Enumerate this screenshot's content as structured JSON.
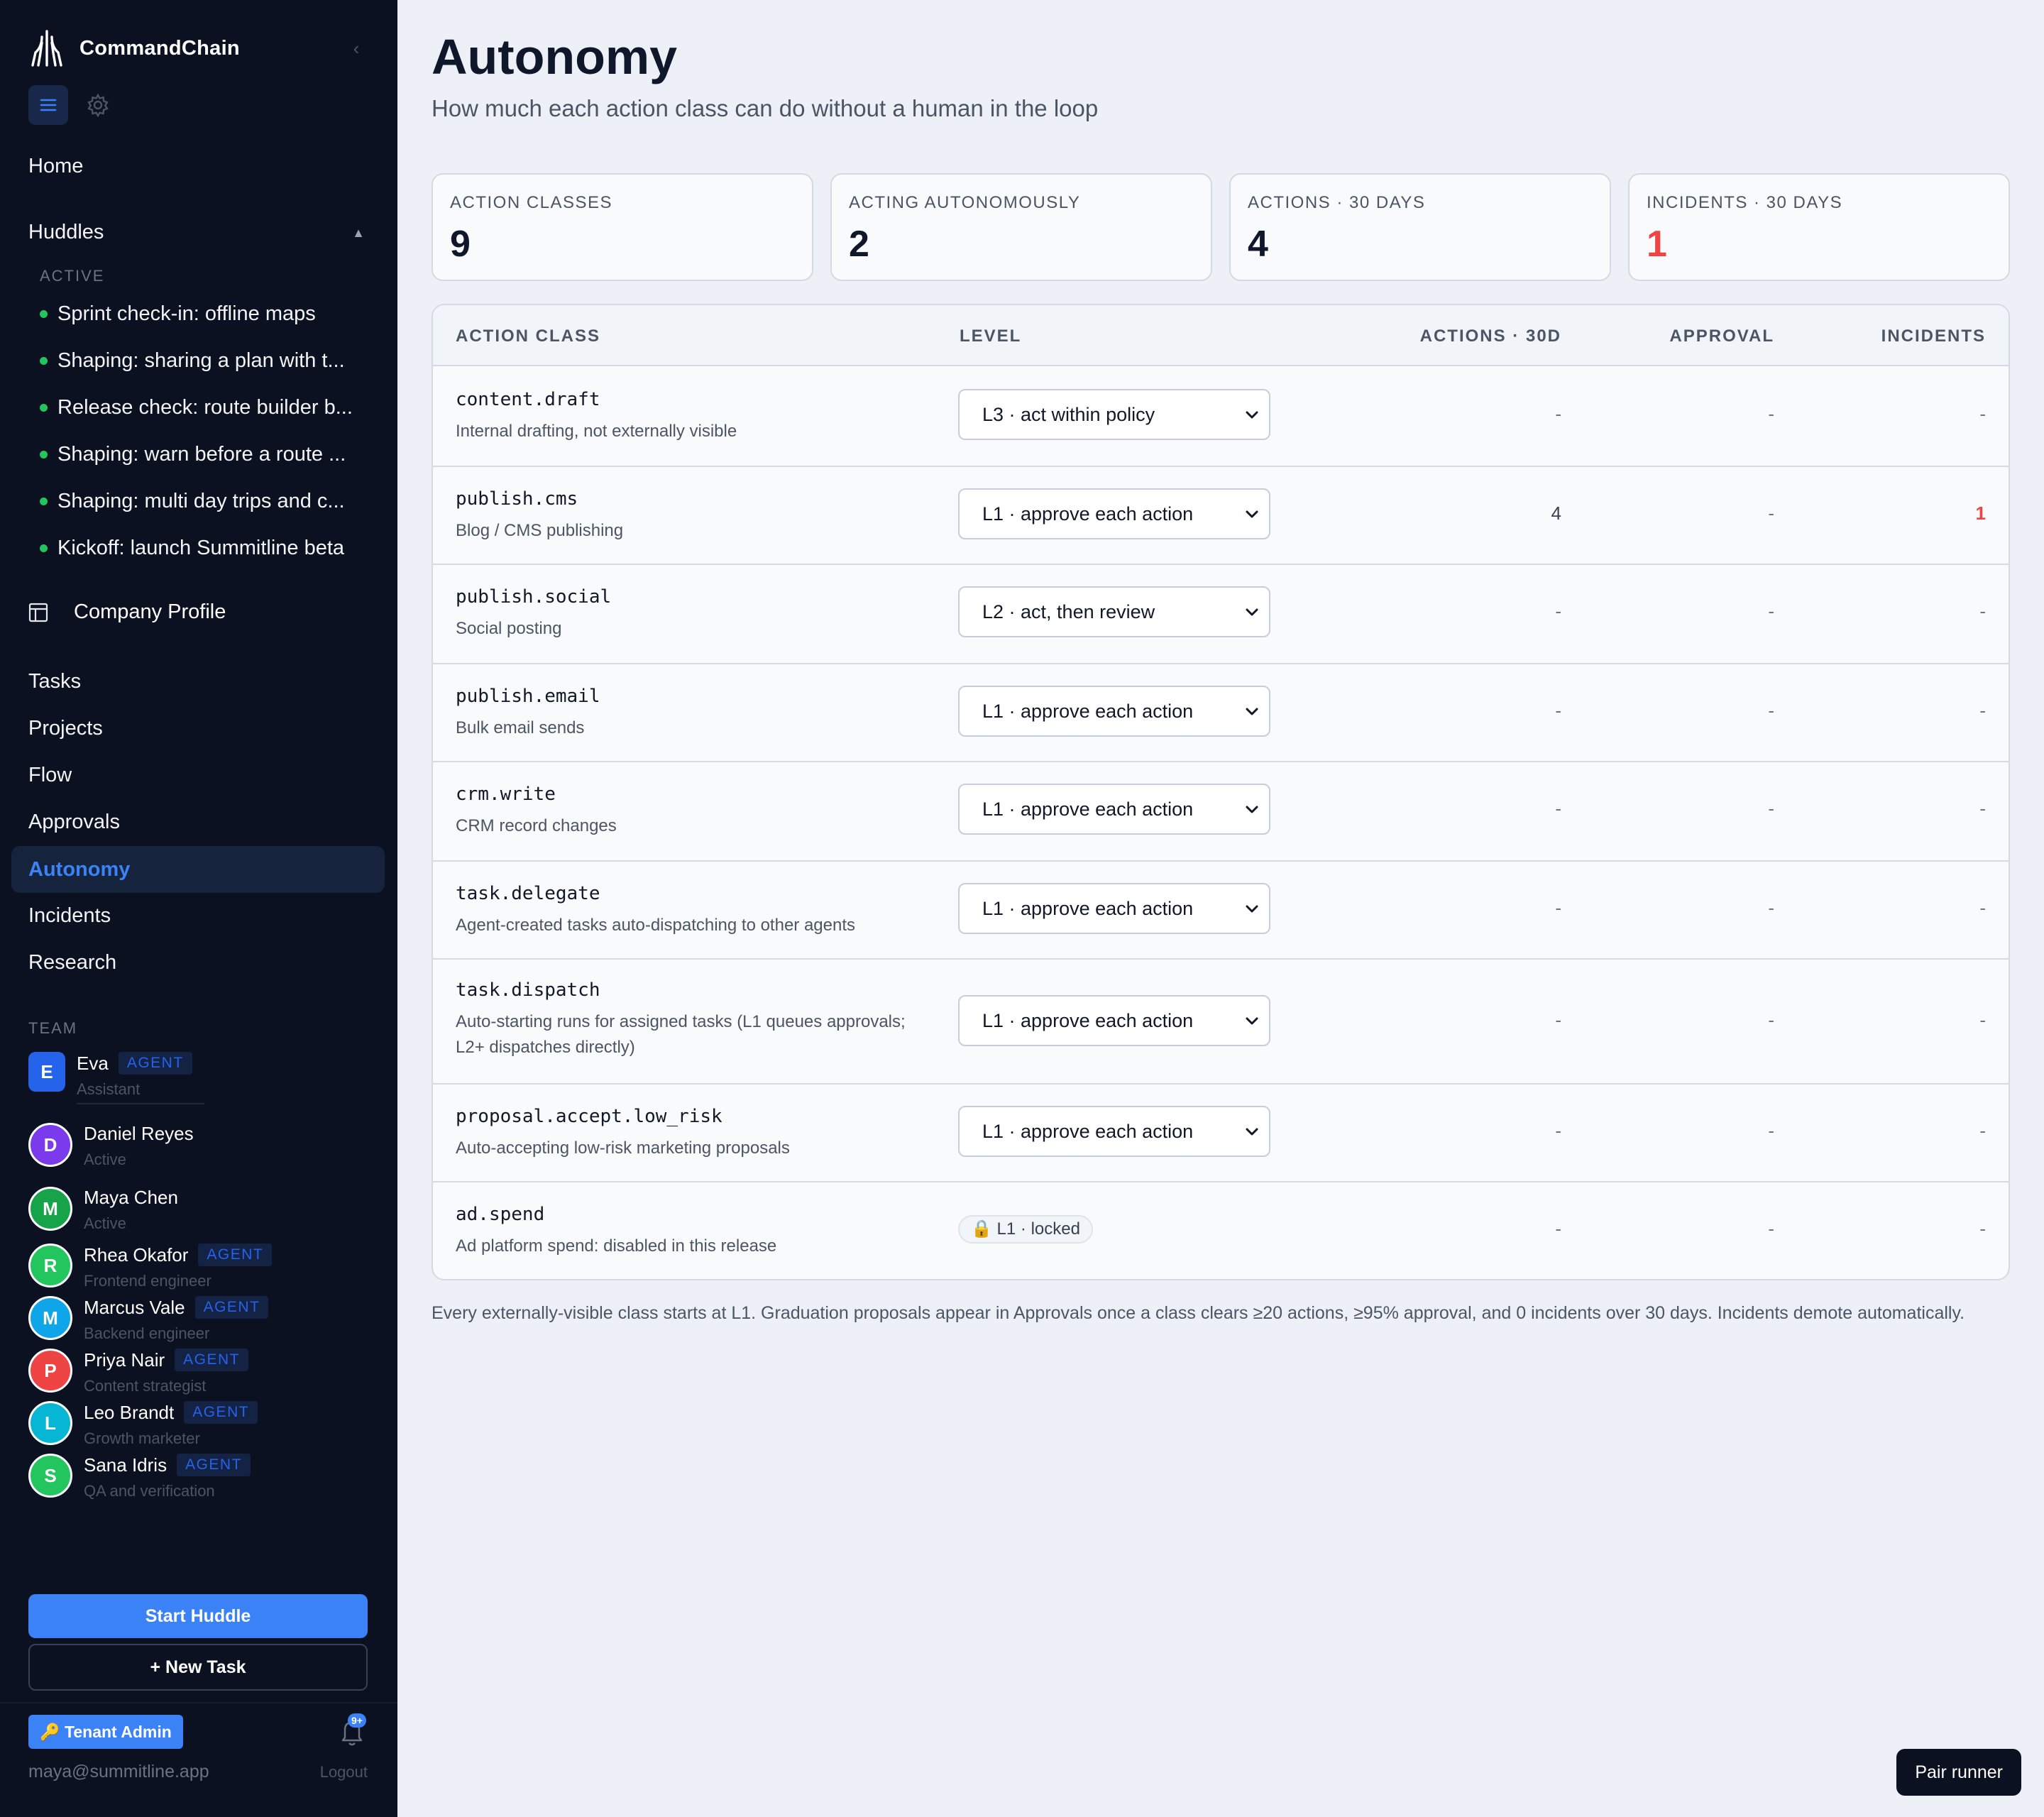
{
  "sidebar": {
    "brand": "CommandChain",
    "collapse_glyph": "‹",
    "nav_home": "Home",
    "nav_huddles": "Huddles",
    "huddles_caret": "▲",
    "active_label": "ACTIVE",
    "huddles": [
      "Sprint check-in: offline maps",
      "Shaping: sharing a plan with t...",
      "Release check: route builder b...",
      "Shaping: warn before a route ...",
      "Shaping: multi day trips and c...",
      "Kickoff: launch Summitline beta"
    ],
    "company_profile": "Company Profile",
    "nav": [
      "Tasks",
      "Projects",
      "Flow",
      "Approvals",
      "Autonomy",
      "Incidents",
      "Research"
    ],
    "team_label": "TEAM",
    "team": [
      {
        "initial": "E",
        "name": "Eva",
        "badge": "AGENT",
        "role": "Assistant",
        "color": "#2563eb"
      },
      {
        "initial": "D",
        "name": "Daniel Reyes",
        "badge": "",
        "role": "Active",
        "color": "#7c3aed"
      },
      {
        "initial": "M",
        "name": "Maya Chen",
        "badge": "",
        "role": "Active",
        "color": "#16a34a"
      },
      {
        "initial": "R",
        "name": "Rhea Okafor",
        "badge": "AGENT",
        "role": "Frontend engineer",
        "color": "#22c55e"
      },
      {
        "initial": "M",
        "name": "Marcus Vale",
        "badge": "AGENT",
        "role": "Backend engineer",
        "color": "#0ea5e9"
      },
      {
        "initial": "P",
        "name": "Priya Nair",
        "badge": "AGENT",
        "role": "Content strategist",
        "color": "#ef4444"
      },
      {
        "initial": "L",
        "name": "Leo Brandt",
        "badge": "AGENT",
        "role": "Growth marketer",
        "color": "#06b6d4"
      },
      {
        "initial": "S",
        "name": "Sana Idris",
        "badge": "AGENT",
        "role": "QA and verification",
        "color": "#22c55e"
      }
    ],
    "start_huddle": "Start Huddle",
    "new_task": "+ New Task",
    "tenant_admin": "🔑 Tenant Admin",
    "notif_count": "9+",
    "user_email": "maya@summitline.app",
    "logout": "Logout"
  },
  "page": {
    "title": "Autonomy",
    "subtitle": "How much each action class can do without a human in the loop"
  },
  "stats": [
    {
      "label": "ACTION CLASSES",
      "value": "9",
      "color": "#0f172a"
    },
    {
      "label": "ACTING AUTONOMOUSLY",
      "value": "2",
      "color": "#0f172a"
    },
    {
      "label": "ACTIONS · 30 DAYS",
      "value": "4",
      "color": "#0f172a"
    },
    {
      "label": "INCIDENTS · 30 DAYS",
      "value": "1",
      "color": "#ef4444"
    }
  ],
  "table": {
    "headers": {
      "action_class": "ACTION CLASS",
      "level": "LEVEL",
      "actions": "ACTIONS · 30D",
      "approval": "APPROVAL",
      "incidents": "INCIDENTS"
    },
    "rows": [
      {
        "name": "content.draft",
        "desc": "Internal drafting, not externally visible",
        "level": "L3 · act within policy",
        "actions": "-",
        "approval": "-",
        "incidents": "-"
      },
      {
        "name": "publish.cms",
        "desc": "Blog / CMS publishing",
        "level": "L1 · approve each action",
        "actions": "4",
        "approval": "-",
        "incidents": "1"
      },
      {
        "name": "publish.social",
        "desc": "Social posting",
        "level": "L2 · act, then review",
        "actions": "-",
        "approval": "-",
        "incidents": "-"
      },
      {
        "name": "publish.email",
        "desc": "Bulk email sends",
        "level": "L1 · approve each action",
        "actions": "-",
        "approval": "-",
        "incidents": "-"
      },
      {
        "name": "crm.write",
        "desc": "CRM record changes",
        "level": "L1 · approve each action",
        "actions": "-",
        "approval": "-",
        "incidents": "-"
      },
      {
        "name": "task.delegate",
        "desc": "Agent-created tasks auto-dispatching to other agents",
        "level": "L1 · approve each action",
        "actions": "-",
        "approval": "-",
        "incidents": "-"
      },
      {
        "name": "task.dispatch",
        "desc": "Auto-starting runs for assigned tasks (L1 queues approvals; L2+ dispatches directly)",
        "level": "L1 · approve each action",
        "actions": "-",
        "approval": "-",
        "incidents": "-"
      },
      {
        "name": "proposal.accept.low_risk",
        "desc": "Auto-accepting low-risk marketing proposals",
        "level": "L1 · approve each action",
        "actions": "-",
        "approval": "-",
        "incidents": "-"
      },
      {
        "name": "ad.spend",
        "desc": "Ad platform spend: disabled in this release",
        "level": "🔒 L1 · locked",
        "locked": true,
        "actions": "-",
        "approval": "-",
        "incidents": "-"
      }
    ]
  },
  "footnote": "Every externally-visible class starts at L1. Graduation proposals appear in Approvals once a class clears ≥20 actions, ≥95% approval, and 0 incidents over 30 days. Incidents demote automatically.",
  "pair_runner": "Pair runner",
  "colors": {
    "accent": "#3b82f6",
    "sidebar_bg": "#0b1120",
    "danger": "#ef4444",
    "online": "#22c55e"
  }
}
